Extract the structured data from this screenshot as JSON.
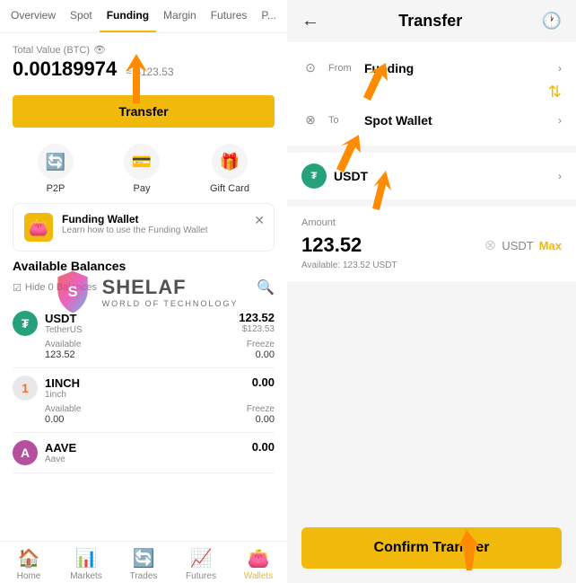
{
  "left": {
    "tabs": [
      {
        "label": "Overview",
        "active": false
      },
      {
        "label": "Spot",
        "active": false
      },
      {
        "label": "Funding",
        "active": true
      },
      {
        "label": "Margin",
        "active": false
      },
      {
        "label": "Futures",
        "active": false
      },
      {
        "label": "P...",
        "active": false
      }
    ],
    "walletLabel": "Total Value (BTC)",
    "walletBTC": "0.00189974",
    "walletUSD": "≈ $123.53",
    "transferBtn": "Transfer",
    "icons": [
      {
        "icon": "🔄",
        "label": "P2P"
      },
      {
        "icon": "💳",
        "label": "Pay"
      },
      {
        "icon": "🎁",
        "label": "Gift Card"
      }
    ],
    "tooltip": {
      "title": "Funding Wallet",
      "desc": "Learn how to use the Funding Wallet"
    },
    "balancesTitle": "Available Balances",
    "hideLabel": "Hide 0 Balances",
    "coins": [
      {
        "symbol": "USDT",
        "name": "TetherUS",
        "iconBg": "#26a17b",
        "iconColor": "#fff",
        "iconText": "₮",
        "amount": "123.52",
        "usd": "$123.53",
        "available": "123.52",
        "freeze": "0.00"
      },
      {
        "symbol": "1INCH",
        "name": "1inch",
        "iconBg": "#e8e8e8",
        "iconColor": "#ff6b35",
        "iconText": "1",
        "amount": "0.00",
        "usd": "",
        "available": "0.00",
        "freeze": "0.00"
      },
      {
        "symbol": "AAVE",
        "name": "Aave",
        "iconBg": "#B6509E",
        "iconColor": "#fff",
        "iconText": "A",
        "amount": "0.00",
        "usd": "",
        "available": "0.00",
        "freeze": "0.00"
      }
    ],
    "bottomNav": [
      {
        "icon": "🏠",
        "label": "Home",
        "active": false
      },
      {
        "icon": "📊",
        "label": "Markets",
        "active": false
      },
      {
        "icon": "🔄",
        "label": "Trades",
        "active": false
      },
      {
        "icon": "📈",
        "label": "Futures",
        "active": false
      },
      {
        "icon": "👛",
        "label": "Wallets",
        "active": true
      }
    ]
  },
  "right": {
    "backIcon": "←",
    "historyIcon": "🕐",
    "title": "Transfer",
    "fromLabel": "From",
    "fromValue": "Funding",
    "toLabel": "To",
    "toValue": "Spot Wallet",
    "coinSymbol": "USDT",
    "amountLabel": "Amount",
    "amountValue": "123.52",
    "amountUnit": "USDT",
    "maxBtn": "Max",
    "available": "Available: 123.52 USDT",
    "confirmBtn": "Confirm Transfer"
  }
}
